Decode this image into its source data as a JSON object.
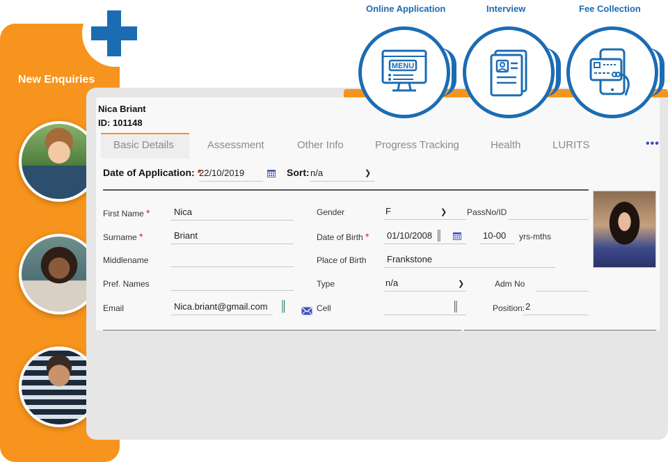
{
  "sidebar": {
    "title": "New Enquiries"
  },
  "top_features": [
    {
      "label": "Online Application",
      "icon": "menu-monitor-icon"
    },
    {
      "label": "Interview",
      "icon": "document-profile-icon"
    },
    {
      "label": "Fee Collection",
      "icon": "card-phone-icon"
    }
  ],
  "menu_screen_text": "MENU",
  "student": {
    "name": "Nica Briant",
    "id": "ID: 101148"
  },
  "tabs": [
    {
      "label": "Basic Details",
      "active": true
    },
    {
      "label": "Assessment"
    },
    {
      "label": "Other Info"
    },
    {
      "label": "Progress Tracking"
    },
    {
      "label": "Health"
    },
    {
      "label": "LURITS"
    }
  ],
  "tabs_more": "•••",
  "application": {
    "label": "Date of Application:",
    "required_mark": "*",
    "date": "22/10/2019",
    "sort_label": "Sort:",
    "sort_value": "n/a"
  },
  "form": {
    "first_name": {
      "label": "First Name",
      "required": "*",
      "value": "Nica"
    },
    "surname": {
      "label": "Surname",
      "required": "*",
      "value": "Briant"
    },
    "middlename": {
      "label": "Middlename",
      "value": ""
    },
    "pref_names": {
      "label": "Pref. Names",
      "value": ""
    },
    "email": {
      "label": "Email",
      "value": "Nica.briant@gmail.com"
    },
    "gender": {
      "label": "Gender",
      "value": "F"
    },
    "passno": {
      "label": "PassNo/ID",
      "value": ""
    },
    "dob": {
      "label": "Date of Birth",
      "required": "*",
      "value": "01/10/2008"
    },
    "age": {
      "value": "10-00",
      "unit": "yrs-mths"
    },
    "place_of_birth": {
      "label": "Place of Birth",
      "value": "Frankstone"
    },
    "type": {
      "label": "Type",
      "value": "n/a"
    },
    "adm_no": {
      "label": "Adm No",
      "value": ""
    },
    "cell": {
      "label": "Cell",
      "value": ""
    },
    "position": {
      "label": "Position:",
      "value": "2"
    }
  },
  "colors": {
    "orange": "#f7941d",
    "blue": "#1b6cb3",
    "required": "#e01818",
    "tab_inactive": "#8a8a8a"
  }
}
